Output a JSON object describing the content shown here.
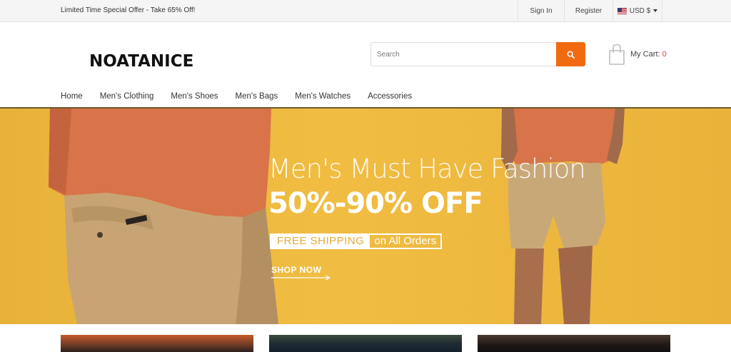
{
  "topbar": {
    "promo": "Limited Time Special Offer - Take 65% Off!",
    "sign_in": "Sign In",
    "register": "Register",
    "currency": "USD $"
  },
  "header": {
    "logo": "NOATANICE",
    "search_placeholder": "Search",
    "cart_label": "My Cart: ",
    "cart_count": "0"
  },
  "nav": {
    "items": [
      "Home",
      "Men's Clothing",
      "Men's Shoes",
      "Men's Bags",
      "Men's Watches",
      "Accessories"
    ]
  },
  "hero": {
    "title": "Men's Must Have Fashion",
    "sale": "50%-90% OFF",
    "shipping_left": "FREE SHIPPING",
    "shipping_right": "on All Orders",
    "cta": "SHOP NOW"
  },
  "colors": {
    "accent": "#f26a10",
    "hero_bg": "#f0bd42",
    "cart_count": "#e53935"
  }
}
